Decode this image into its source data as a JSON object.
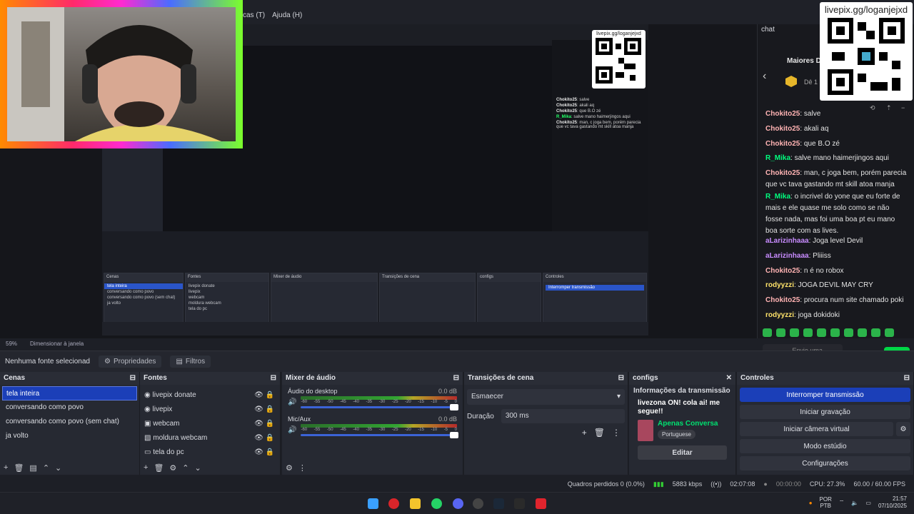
{
  "menu": [
    "cas (T)",
    "Ajuda (H)"
  ],
  "qr": {
    "label": "livepix.gg/loganjejxd"
  },
  "chat": {
    "title": "chat",
    "header": "Maiores D",
    "header_sub": "Dê 1 i",
    "messages": [
      {
        "user": "Chokito25",
        "sep": ": ",
        "text": "salve",
        "color": "orange"
      },
      {
        "user": "Chokito25",
        "sep": ": ",
        "text": "akali aq",
        "color": "orange"
      },
      {
        "user": "Chokito25",
        "sep": ": ",
        "text": "que B.O zé",
        "color": "orange"
      },
      {
        "user": "R_Mika",
        "sep": ": ",
        "text": "salve mano haimerjingos aqui",
        "color": "green"
      },
      {
        "user": "Chokito25",
        "sep": ": ",
        "text": "man, c joga bem, porém parecia que vc tava gastando mt skill atoa manja",
        "color": "orange"
      },
      {
        "user": "R_Mika",
        "sep": ": ",
        "text": "o incrivel do yone que eu forte de mais e ele quase me solo como se não fosse nada, mas foi uma boa pt eu mano boa sorte com as lives.",
        "color": "green"
      },
      {
        "user": "aLarizinhaaa",
        "sep": ": ",
        "text": "Joga level Devil",
        "color": "purple"
      },
      {
        "user": "aLarizinhaaa",
        "sep": ": ",
        "text": "Pliiiss",
        "color": "purple"
      },
      {
        "user": "Chokito25",
        "sep": ": ",
        "text": "n é no robox",
        "color": "orange"
      },
      {
        "user": "rodyyzzi",
        "sep": ": ",
        "text": "JOGA DEVIL MAY CRY",
        "color": "yellow"
      },
      {
        "user": "Chokito25",
        "sep": ": ",
        "text": "procura num site chamado poki",
        "color": "orange"
      },
      {
        "user": "rodyyzzi",
        "sep": ": ",
        "text": "joga dokidoki",
        "color": "yellow"
      }
    ],
    "input_placeholder": "Envie uma mensagem",
    "send_label": "Chat"
  },
  "zoom": {
    "level": "59%",
    "mode": "Dimensionar à janela"
  },
  "source_bar": {
    "status": "Nenhuma fonte selecionad",
    "props": "Propriedades",
    "filters": "Filtros"
  },
  "scenes": {
    "title": "Cenas",
    "items": [
      "tela inteira",
      "conversando como povo",
      "conversando como povo (sem chat)",
      "ja volto"
    ],
    "selected": 0
  },
  "sources": {
    "title": "Fontes",
    "items": [
      "livepix donate",
      "livepix",
      "webcam",
      "moldura webcam",
      "tela do pc"
    ]
  },
  "mixer": {
    "title": "Mixer de áudio",
    "channels": [
      {
        "name": "Áudio do desktop",
        "db": "0.0 dB"
      },
      {
        "name": "Mic/Aux",
        "db": "0.0 dB"
      }
    ],
    "ticks": [
      "-60",
      "-55",
      "-50",
      "-45",
      "-40",
      "-35",
      "-30",
      "-25",
      "-20",
      "-15",
      "-10",
      "-5",
      "0"
    ]
  },
  "transitions": {
    "title": "Transições de cena",
    "selected": "Esmaecer",
    "duration_label": "Duração",
    "duration": "300 ms"
  },
  "configs": {
    "title": "configs",
    "info_title": "Informações da transmissão",
    "stream_title": "livezona ON! cola ai! me segue!!",
    "category": "Apenas Conversa",
    "tag": "Portuguese",
    "edit": "Editar"
  },
  "controls": {
    "title": "Controles",
    "buttons": [
      "Interromper transmissão",
      "Iniciar gravação",
      "Iniciar câmera virtual",
      "Modo estúdio",
      "Configurações"
    ]
  },
  "status": {
    "dropped": "Quadros perdidos 0 (0.0%)",
    "bitrate": "5883 kbps",
    "live_time": "02:07:08",
    "rec_time": "00:00:00",
    "cpu": "CPU: 27.3%",
    "fps": "60.00 / 60.00 FPS"
  },
  "tray": {
    "lang1": "POR",
    "lang2": "PTB",
    "time": "21:57",
    "date": "07/10/2025"
  },
  "colors": {
    "accent": "#1b3fb8",
    "chat_green": "#00d646"
  }
}
